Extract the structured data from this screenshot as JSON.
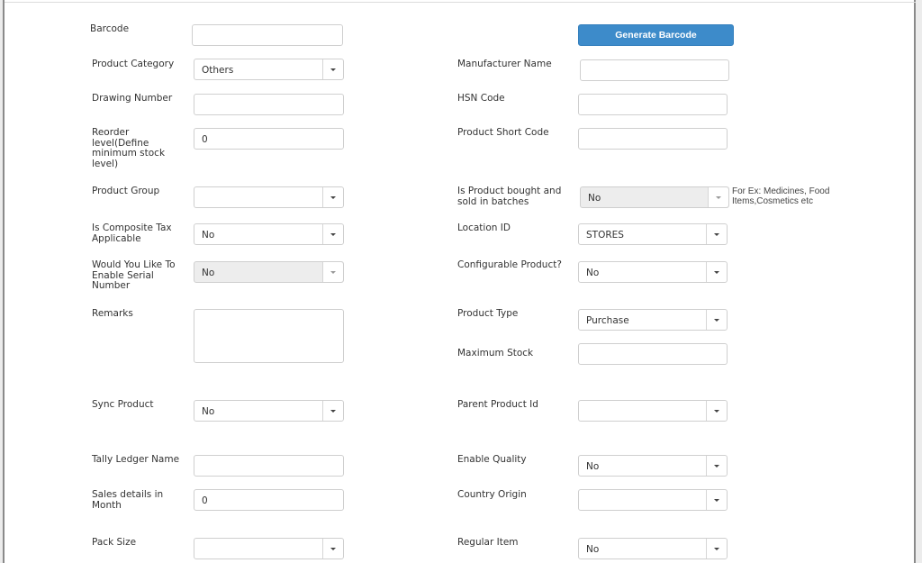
{
  "left": {
    "barcode": {
      "label": "Barcode",
      "value": ""
    },
    "product_category": {
      "label": "Product Category",
      "value": "Others"
    },
    "drawing_number": {
      "label": "Drawing Number",
      "value": ""
    },
    "reorder_level": {
      "label": "Reorder level(Define minimum stock level)",
      "value": "0"
    },
    "product_group": {
      "label": "Product Group",
      "value": ""
    },
    "composite_tax": {
      "label": "Is Composite Tax Applicable",
      "value": "No"
    },
    "serial_number": {
      "label": "Would You Like To Enable Serial Number",
      "value": "No"
    },
    "remarks": {
      "label": "Remarks",
      "value": ""
    },
    "sync_product": {
      "label": "Sync Product",
      "value": "No"
    },
    "tally_ledger": {
      "label": "Tally Ledger Name",
      "value": ""
    },
    "sales_details": {
      "label": "Sales details in Month",
      "value": "0"
    },
    "pack_size": {
      "label": "Pack Size",
      "value": ""
    }
  },
  "right": {
    "generate_barcode_label": "Generate Barcode",
    "manufacturer_name": {
      "label": "Manufacturer Name",
      "value": ""
    },
    "hsn_code": {
      "label": "HSN Code",
      "value": ""
    },
    "product_short_code": {
      "label": "Product Short Code",
      "value": ""
    },
    "batches": {
      "label": "Is Product bought and sold in batches",
      "value": "No",
      "hint": "For Ex: Medicines, Food Items,Cosmetics etc"
    },
    "location_id": {
      "label": "Location ID",
      "value": "STORES"
    },
    "configurable_product": {
      "label": "Configurable Product?",
      "value": "No"
    },
    "product_type": {
      "label": "Product Type",
      "value": "Purchase"
    },
    "maximum_stock": {
      "label": "Maximum Stock",
      "value": ""
    },
    "parent_product_id": {
      "label": "Parent Product Id",
      "value": ""
    },
    "enable_quality": {
      "label": "Enable Quality",
      "value": "No"
    },
    "country_origin": {
      "label": "Country Origin",
      "value": ""
    },
    "regular_item": {
      "label": "Regular Item",
      "value": "No"
    }
  },
  "colors": {
    "primary_button": "#3d8bca"
  }
}
